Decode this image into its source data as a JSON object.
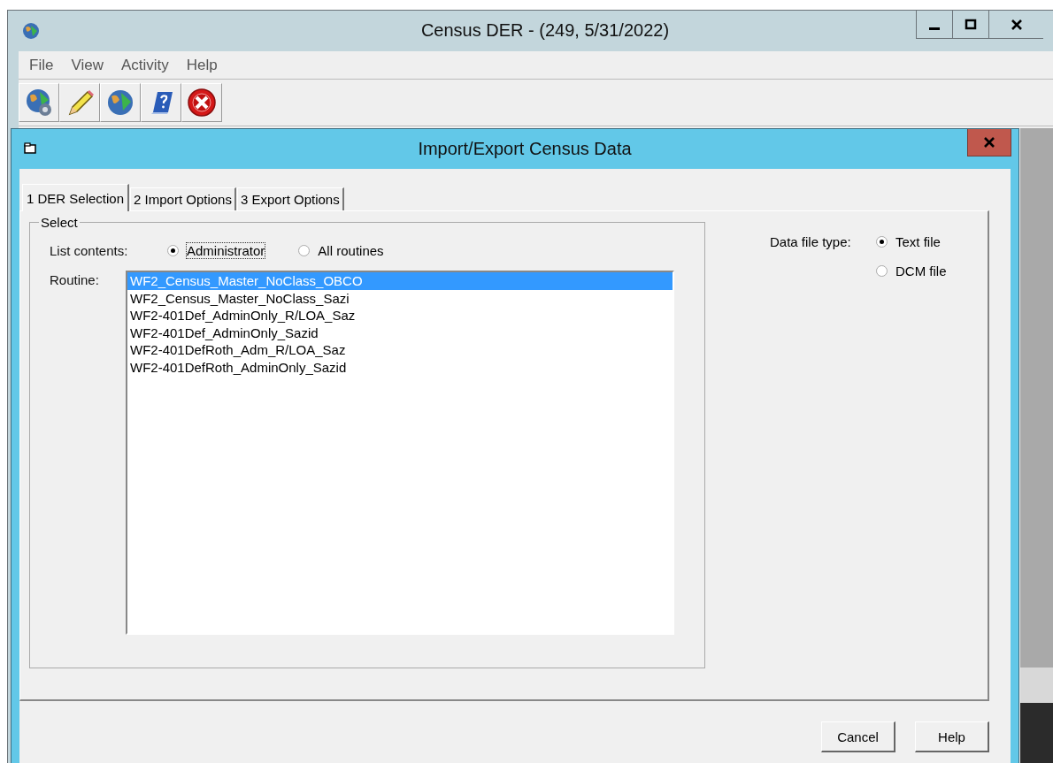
{
  "window": {
    "title": "Census DER - (249,  5/31/2022)"
  },
  "menu": [
    "File",
    "View",
    "Activity",
    "Help"
  ],
  "toolbar": [
    {
      "kind": "globe-gear"
    },
    {
      "kind": "pencil"
    },
    {
      "kind": "globe"
    },
    {
      "kind": "help-book"
    },
    {
      "kind": "close"
    }
  ],
  "dialog": {
    "title": "Import/Export Census Data",
    "tabs": [
      {
        "label": "1 DER Selection",
        "selected": true
      },
      {
        "label": "2 Import Options",
        "selected": false
      },
      {
        "label": "3 Export Options",
        "selected": false
      }
    ],
    "group": {
      "title": "Select",
      "list_contents": {
        "label": "List contents:",
        "options": [
          {
            "label": "Administrator",
            "selected": true
          },
          {
            "label": "All routines",
            "selected": false
          }
        ]
      },
      "routine": {
        "label": "Routine:",
        "items": [
          {
            "label": "WF2_Census_Master_NoClass_OBCO",
            "selected": true
          },
          {
            "label": "WF2_Census_Master_NoClass_Sazi",
            "selected": false
          },
          {
            "label": "WF2-401Def_AdminOnly_R/LOA_Saz",
            "selected": false
          },
          {
            "label": "WF2-401Def_AdminOnly_Sazid",
            "selected": false
          },
          {
            "label": "WF2-401DefRoth_Adm_R/LOA_Saz",
            "selected": false
          },
          {
            "label": "WF2-401DefRoth_AdminOnly_Sazid",
            "selected": false
          }
        ]
      }
    },
    "data_file_type": {
      "label": "Data file type:",
      "options": [
        {
          "label": "Text file",
          "selected": true
        },
        {
          "label": "DCM file",
          "selected": false
        }
      ]
    },
    "buttons": [
      "Cancel",
      "Help"
    ]
  }
}
